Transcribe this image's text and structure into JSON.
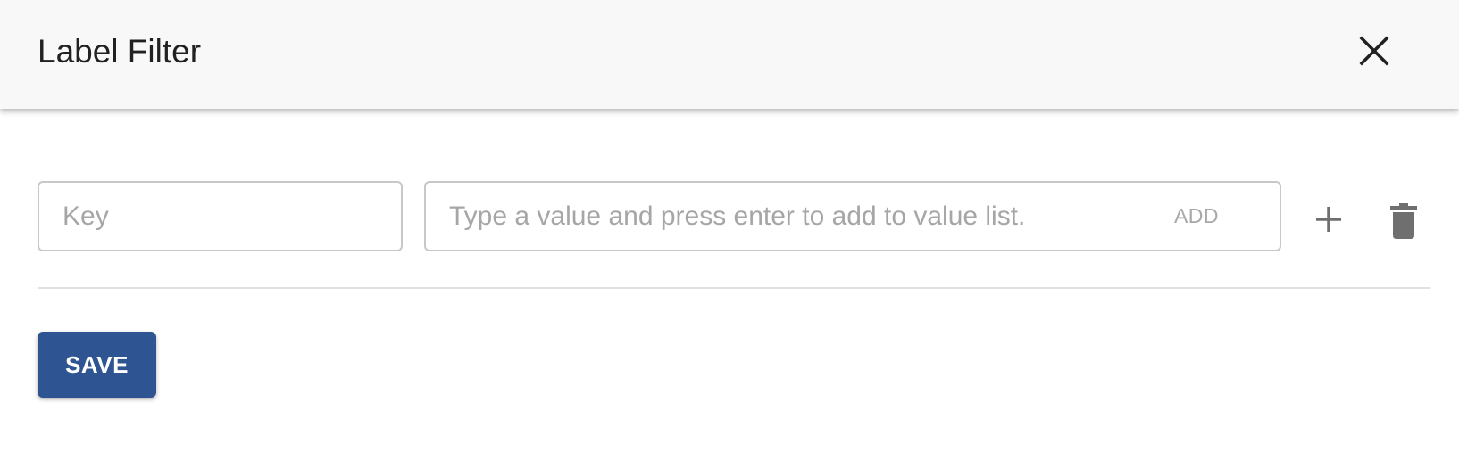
{
  "dialog": {
    "title": "Label Filter",
    "close_icon": "close-icon"
  },
  "filter_row": {
    "key_placeholder": "Key",
    "key_value": "",
    "value_placeholder": "Type a value and press enter to add to value list.",
    "value_value": "",
    "add_label": "ADD",
    "plus_icon": "plus-icon",
    "trash_icon": "trash-icon"
  },
  "footer": {
    "save_label": "SAVE"
  },
  "colors": {
    "header_background": "#f8f8f8",
    "save_button": "#2e5591",
    "icon_gray": "#6f6f6f",
    "placeholder_gray": "#a6a6a6"
  }
}
